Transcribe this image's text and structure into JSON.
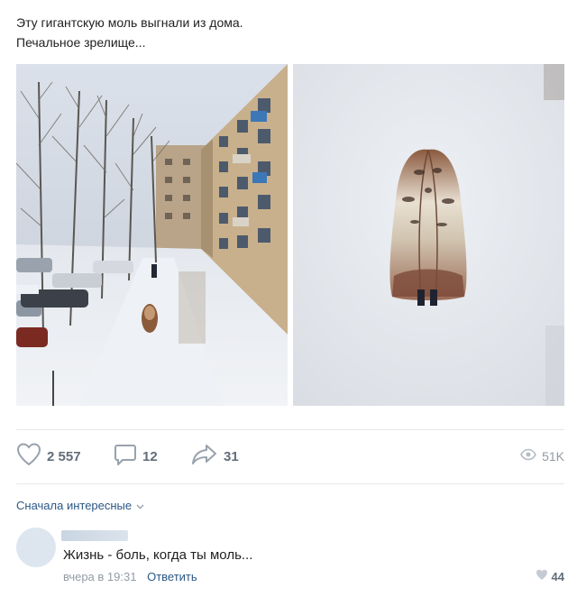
{
  "post": {
    "text_line1": "Эту гигантскую моль выгнали из дома.",
    "text_line2": "Печальное зрелище..."
  },
  "actions": {
    "likes": "2 557",
    "comments": "12",
    "shares": "31",
    "views": "51K"
  },
  "comments": {
    "sort_label": "Сначала интересные",
    "items": [
      {
        "text": "Жизнь - боль, когда ты моль...",
        "time": "вчера в 19:31",
        "reply_label": "Ответить",
        "likes": "44"
      }
    ]
  },
  "colors": {
    "link": "#2a5885",
    "icon": "#99a2ad",
    "divider": "#e7e8ec"
  },
  "icons": [
    "heart-icon",
    "comment-icon",
    "share-icon",
    "eye-icon",
    "chevron-down-icon"
  ]
}
